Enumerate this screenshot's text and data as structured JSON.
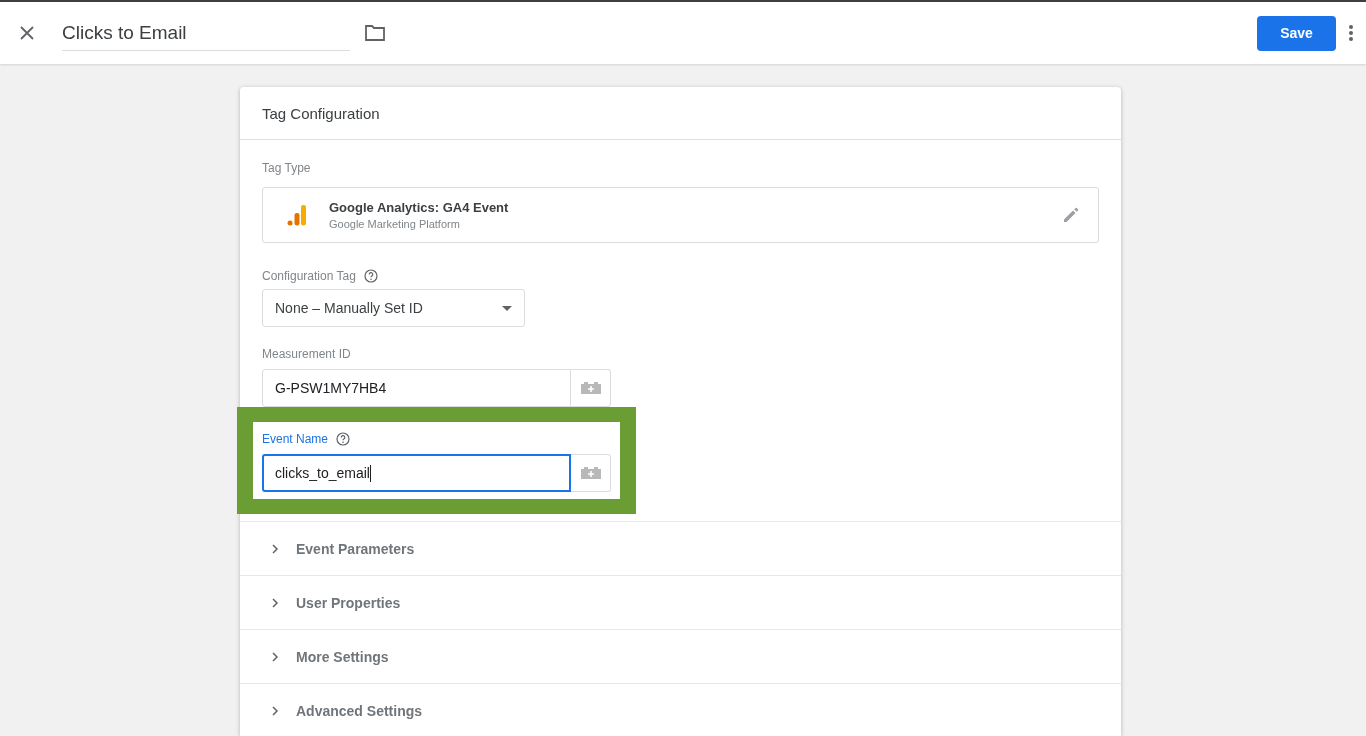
{
  "header": {
    "title": "Clicks to Email",
    "save_label": "Save"
  },
  "card": {
    "title": "Tag Configuration",
    "tag_type": {
      "label": "Tag Type",
      "name": "Google Analytics: GA4 Event",
      "vendor": "Google Marketing Platform"
    },
    "configuration_tag": {
      "label": "Configuration Tag",
      "value": "None – Manually Set ID"
    },
    "fields": [
      {
        "label": "Measurement ID",
        "value": "G-PSW1MY7HB4",
        "focused": false,
        "highlighted": false,
        "help": false
      },
      {
        "label": "Event Name",
        "value": "clicks_to_email",
        "focused": true,
        "highlighted": true,
        "help": true
      }
    ],
    "sections": [
      {
        "label": "Event Parameters",
        "expanded": false
      },
      {
        "label": "User Properties",
        "expanded": false
      },
      {
        "label": "More Settings",
        "expanded": false
      },
      {
        "label": "Advanced Settings",
        "expanded": false
      }
    ]
  }
}
